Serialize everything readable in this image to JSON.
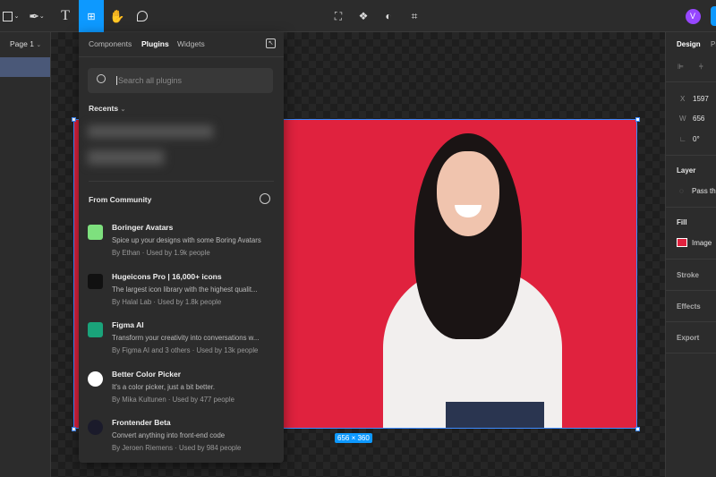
{
  "toolbar": {
    "avatar_initial": "V",
    "accent": "#0d99ff"
  },
  "left_panel": {
    "page_label": "Page 1"
  },
  "popover": {
    "tabs": [
      "Components",
      "Plugins",
      "Widgets"
    ],
    "search_placeholder": "Search all plugins",
    "recents_label": "Recents",
    "community_label": "From Community",
    "plugins": [
      {
        "name": "Boringer Avatars",
        "description": "Spice up your designs with some Boring Avatars",
        "meta": "By Ethan · Used by 1.9k people",
        "icon_color": "#7ee07e"
      },
      {
        "name": "Hugeicons Pro | 16,000+ icons",
        "description": "The largest icon library with the highest qualit...",
        "meta": "By Halal Lab · Used by 1.8k people",
        "icon_color": "#111111"
      },
      {
        "name": "Figma AI",
        "description": "Transform your creativity into conversations w...",
        "meta": "By Figma AI and 3 others · Used by 13k people",
        "icon_color": "#1aa37a"
      },
      {
        "name": "Better Color Picker",
        "description": "It's a color picker, just a bit better.",
        "meta": "By Mika Kultunen · Used by 477 people",
        "icon_color": "#ffffff"
      },
      {
        "name": "Frontender Beta",
        "description": "Convert anything into front-end code",
        "meta": "By Jeroen Riemens · Used by 984 people",
        "icon_color": "#1b1b2b"
      }
    ]
  },
  "canvas": {
    "size_label": "656 × 360",
    "image_bg": "#e0223e"
  },
  "right_panel": {
    "tabs": [
      "Design",
      "Pr"
    ],
    "x_label": "X",
    "x_value": "1597",
    "w_label": "W",
    "w_value": "656",
    "rotation_value": "0°",
    "layer_label": "Layer",
    "layer_mode": "Pass th",
    "fill_label": "Fill",
    "fill_value": "Image",
    "stroke_label": "Stroke",
    "effects_label": "Effects",
    "export_label": "Export"
  }
}
